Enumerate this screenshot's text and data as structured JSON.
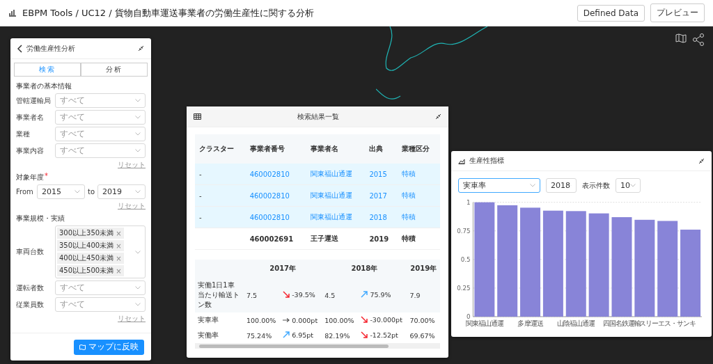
{
  "header": {
    "title": "EBPM Tools / UC12 / 貨物自動車運送事業者の労働生産性に関する分析",
    "buttons": [
      "Defined Data",
      "プレビュー"
    ]
  },
  "search_panel": {
    "title": "労働生産性分析",
    "tabs": [
      {
        "label": "検索",
        "selected": true
      },
      {
        "label": "分析",
        "selected": false
      }
    ],
    "sections": [
      {
        "title": "事業者の基本情報",
        "fields": [
          {
            "kind": "select",
            "label": "管轄運輸局",
            "placeholder": "すべて"
          },
          {
            "kind": "select",
            "label": "事業者名",
            "placeholder": "すべて"
          },
          {
            "kind": "select",
            "label": "業種",
            "placeholder": "すべて"
          },
          {
            "kind": "select",
            "label": "事業内容",
            "placeholder": "すべて"
          }
        ],
        "reset": "リセット"
      },
      {
        "title": "対象年度",
        "required_mark": "*",
        "fields": [
          {
            "kind": "range",
            "label": "From",
            "from": "2015",
            "to_label": "to",
            "to": "2019"
          }
        ],
        "reset": "リセット"
      },
      {
        "title": "事業規模・実績",
        "fields": [
          {
            "kind": "tags",
            "label": "車両台数",
            "tags": [
              {
                "label": "300以上350未満",
                "remove": "×"
              },
              {
                "label": "350以上400未満",
                "remove": "×"
              },
              {
                "label": "400以上450未満",
                "remove": "×"
              },
              {
                "label": "450以上500未満",
                "remove": "×"
              }
            ]
          },
          {
            "kind": "select",
            "label": "運転者数",
            "placeholder": "すべて"
          },
          {
            "kind": "select",
            "label": "従業員数",
            "placeholder": "すべて"
          }
        ],
        "reset": "リセット"
      }
    ],
    "apply_button": "マップに反映"
  },
  "results_panel": {
    "title": "検索結果一覧",
    "columns": [
      "クラスター",
      "事業者番号",
      "事業者名",
      "出典",
      "業種区分"
    ],
    "rows": [
      {
        "selected": true,
        "cells": [
          "-",
          "460002810",
          "関東福山通運",
          "2015",
          "特積"
        ]
      },
      {
        "selected": true,
        "cells": [
          "-",
          "460002810",
          "関東福山通運",
          "2017",
          "特積"
        ]
      },
      {
        "selected": true,
        "cells": [
          "-",
          "460002810",
          "関東福山通運",
          "2018",
          "特積"
        ]
      },
      {
        "selected": false,
        "cells": [
          "",
          "460002691",
          "王子運送",
          "2019",
          "特積"
        ]
      }
    ],
    "indicator_columns": [
      "2017年",
      "2018年",
      "2019年"
    ],
    "indicator_rows": [
      {
        "name": "実働1日1車当たり輸送トン数",
        "v2017": "7.5",
        "change1": {
          "kind": "down",
          "text": "-39.5%"
        },
        "v2018": "4.5",
        "change2": {
          "kind": "up",
          "text": "75.9%"
        },
        "v2019": "7.9"
      },
      {
        "name": "実車率",
        "v2017": "100.00%",
        "change1": {
          "kind": "flat",
          "text": "0.000pt"
        },
        "v2018": "100.00%",
        "change2": {
          "kind": "down",
          "text": "-30.000pt"
        },
        "v2019": "70.00%"
      },
      {
        "name": "実働率",
        "v2017": "75.24%",
        "change1": {
          "kind": "up",
          "text": "6.95pt"
        },
        "v2018": "82.19%",
        "change2": {
          "kind": "down",
          "text": "-12.52pt"
        },
        "v2019": "69.67%"
      }
    ]
  },
  "chart_panel": {
    "title": "生産性指標",
    "metric": "実車率",
    "year": "2018",
    "count_label": "表示件数",
    "count": "10",
    "chart_data": {
      "type": "bar",
      "categories": [
        "関東福山通運",
        null,
        "多摩運送",
        null,
        "山陰福山通運",
        null,
        "四国名鉄運輸",
        null,
        "スリーエス・サンキ",
        null
      ],
      "values": [
        1.0,
        0.974,
        0.953,
        0.927,
        0.923,
        0.903,
        0.87,
        0.847,
        0.837,
        0.761
      ],
      "ylim": [
        0,
        1
      ],
      "yticks": [
        0,
        0.25,
        0.5,
        0.75,
        1
      ],
      "grid": true
    }
  }
}
